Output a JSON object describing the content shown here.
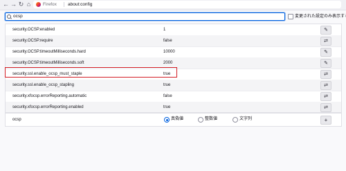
{
  "browser": {
    "back_icon": "←",
    "forward_icon": "→",
    "reload_icon": "↻",
    "home_icon": "⌂",
    "identity_label": "Firefox",
    "url": "about:config"
  },
  "search": {
    "value": "ocsp",
    "placeholder": ""
  },
  "filter": {
    "label": "変更された設定のみ表示する",
    "checked": false
  },
  "preferences": [
    {
      "name": "security.OCSP.enabled",
      "value": "1",
      "action": "edit"
    },
    {
      "name": "security.OCSP.require",
      "value": "false",
      "action": "toggle"
    },
    {
      "name": "security.OCSP.timeoutMilliseconds.hard",
      "value": "10000",
      "action": "edit"
    },
    {
      "name": "security.OCSP.timeoutMilliseconds.soft",
      "value": "2000",
      "action": "edit"
    },
    {
      "name": "security.ssl.enable_ocsp_must_staple",
      "value": "true",
      "action": "toggle"
    },
    {
      "name": "security.ssl.enable_ocsp_stapling",
      "value": "true",
      "action": "toggle"
    },
    {
      "name": "security.xfocsp.errorReporting.automatic",
      "value": "false",
      "action": "toggle"
    },
    {
      "name": "security.xfocsp.errorReporting.enabled",
      "value": "true",
      "action": "toggle"
    }
  ],
  "icons": {
    "edit": "✎",
    "toggle": "⇄",
    "add": "+"
  },
  "new_pref": {
    "name": "ocsp",
    "types": [
      "真偽値",
      "整数値",
      "文字列"
    ],
    "selected": "真偽値"
  },
  "colors": {
    "accent": "#0060df",
    "highlight_border": "#d41f26"
  }
}
